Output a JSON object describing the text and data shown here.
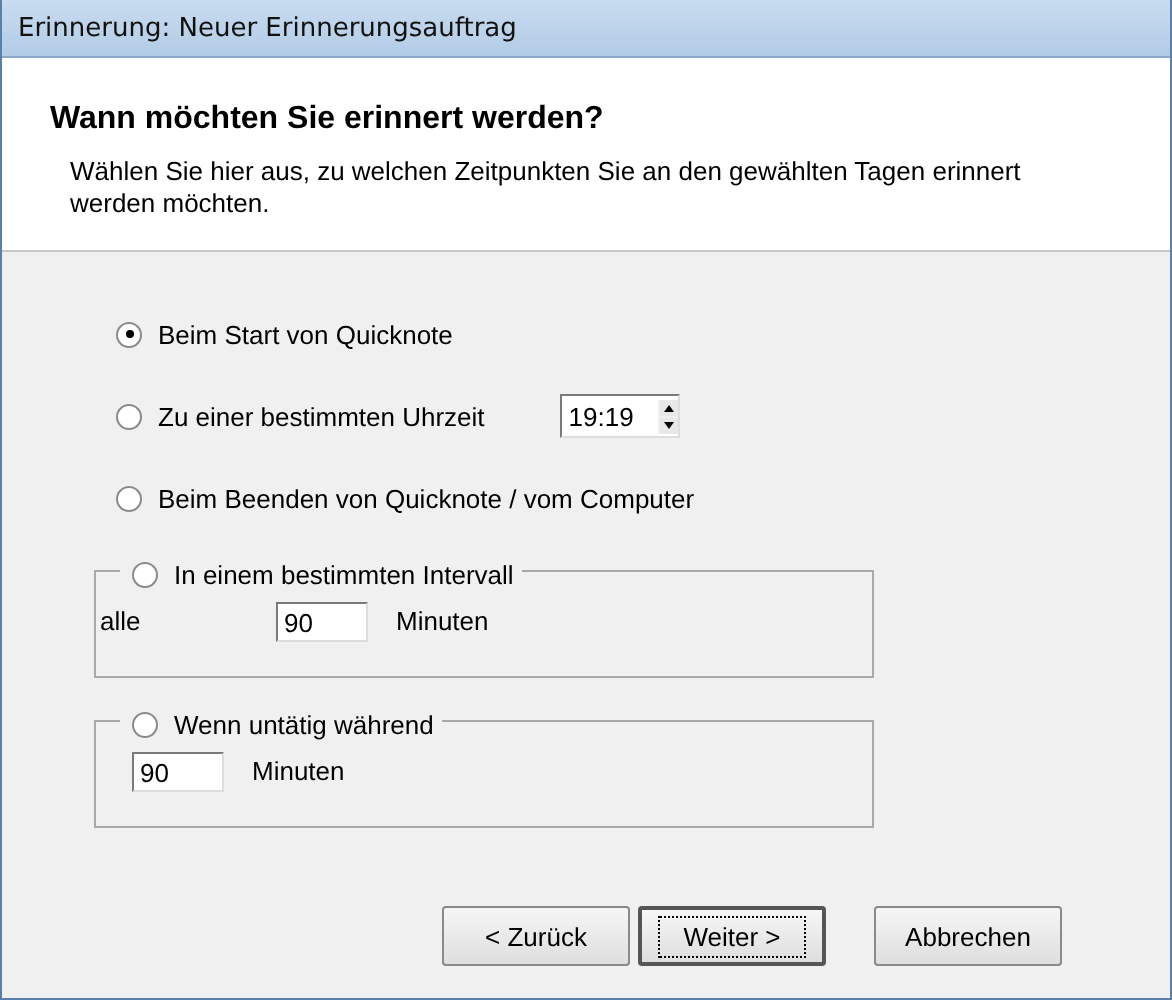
{
  "window": {
    "title": "Erinnerung: Neuer Erinnerungsauftrag"
  },
  "header": {
    "heading": "Wann möchten Sie erinnert werden?",
    "description": "Wählen Sie hier aus, zu welchen Zeitpunkten Sie an den gewählten Tagen erinnert werden möchten."
  },
  "options": [
    {
      "kind": "plain",
      "label": "Beim Start von Quicknote",
      "selected": true
    },
    {
      "kind": "time",
      "label": "Zu einer bestimmten Uhrzeit",
      "selected": false,
      "value": "19:19"
    },
    {
      "kind": "plain",
      "label": "Beim Beenden von Quicknote / vom Computer",
      "selected": false
    },
    {
      "kind": "interval",
      "label": "In einem bestimmten Intervall",
      "selected": false,
      "prefix": "alle",
      "value": "90",
      "unit": "Minuten"
    },
    {
      "kind": "idle",
      "label": "Wenn untätig während",
      "selected": false,
      "value": "90",
      "unit": "Minuten"
    }
  ],
  "buttons": [
    {
      "label": "< Zurück",
      "default": false
    },
    {
      "label": "Weiter >",
      "default": true
    },
    {
      "label": "Abbrechen",
      "default": false
    }
  ]
}
